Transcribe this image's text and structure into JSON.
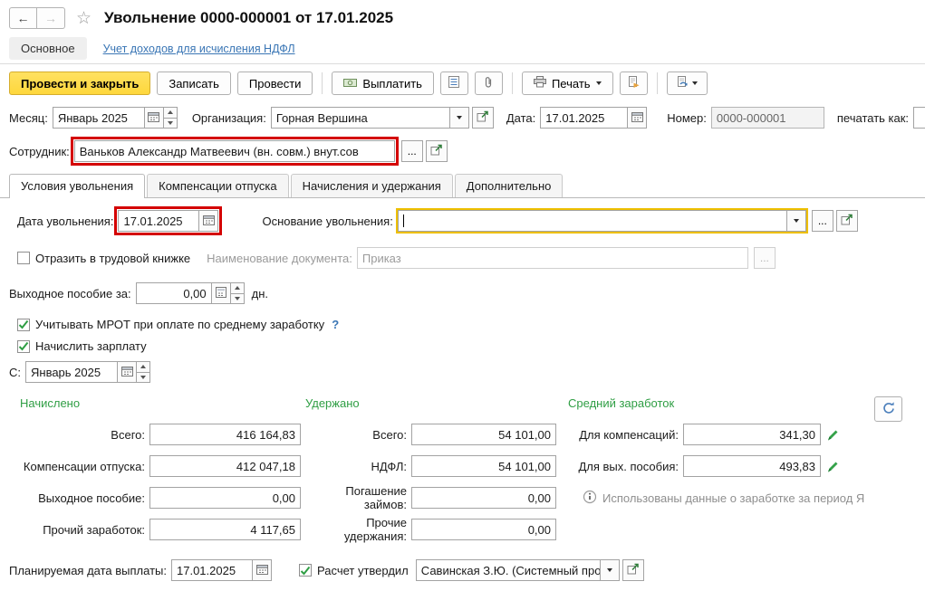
{
  "titlebar": {
    "title": "Увольнение 0000-000001 от 17.01.2025"
  },
  "glyphs": {
    "back": "←",
    "forward": "→",
    "star": "☆",
    "ellipsis": "..."
  },
  "nav": {
    "main": "Основное",
    "ndfl_link": "Учет доходов для исчисления НДФЛ"
  },
  "toolbar": {
    "post_and_close": "Провести и закрыть",
    "write": "Записать",
    "post": "Провести",
    "pay": "Выплатить",
    "print": "Печать"
  },
  "header": {
    "month_label": "Месяц:",
    "month_value": "Январь 2025",
    "org_label": "Организация:",
    "org_value": "Горная Вершина",
    "date_label": "Дата:",
    "date_value": "17.01.2025",
    "number_label": "Номер:",
    "number_value": "0000-000001",
    "print_as_label": "печатать как:",
    "employee_label": "Сотрудник:",
    "employee_value": "Ваньков Александр Матвеевич (вн. совм.) внут.сов"
  },
  "tabs": [
    {
      "label": "Условия увольнения",
      "active": true
    },
    {
      "label": "Компенсации отпуска",
      "active": false
    },
    {
      "label": "Начисления и удержания",
      "active": false
    },
    {
      "label": "Дополнительно",
      "active": false
    }
  ],
  "conditions": {
    "dismissal_date_label": "Дата увольнения:",
    "dismissal_date_value": "17.01.2025",
    "reason_label": "Основание увольнения:",
    "reason_value": "",
    "workbook_label": "Отразить в трудовой книжке",
    "doc_name_label": "Наименование документа:",
    "doc_name_value": "Приказ",
    "severance_label": "Выходное пособие за:",
    "severance_value": "0,00",
    "severance_unit": "дн.",
    "mrot_label": "Учитывать МРОТ при оплате по среднему заработку",
    "mrot_help": "?",
    "accrue_label": "Начислить зарплату",
    "from_label": "С:",
    "from_value": "Январь 2025"
  },
  "calc": {
    "accrued": {
      "header": "Начислено",
      "rows": [
        {
          "label": "Всего:",
          "value": "416 164,83"
        },
        {
          "label": "Компенсации отпуска:",
          "value": "412 047,18"
        },
        {
          "label": "Выходное пособие:",
          "value": "0,00"
        },
        {
          "label": "Прочий заработок:",
          "value": "4 117,65"
        }
      ]
    },
    "withheld": {
      "header": "Удержано",
      "rows": [
        {
          "label": "Всего:",
          "value": "54 101,00"
        },
        {
          "label": "НДФЛ:",
          "value": "54 101,00"
        },
        {
          "label": "Погашение займов:",
          "value": "0,00"
        },
        {
          "label": "Прочие удержания:",
          "value": "0,00"
        }
      ]
    },
    "average": {
      "header": "Средний заработок",
      "rows": [
        {
          "label": "Для компенсаций:",
          "value": "341,30"
        },
        {
          "label": "Для вых. пособия:",
          "value": "493,83"
        }
      ],
      "info_text": "Использованы данные о заработке за период Я"
    }
  },
  "footer": {
    "planned_date_label": "Планируемая дата выплаты:",
    "planned_date_value": "17.01.2025",
    "approved_label": "Расчет утвердил",
    "approved_value": "Савинская З.Ю. (Системный прог"
  }
}
